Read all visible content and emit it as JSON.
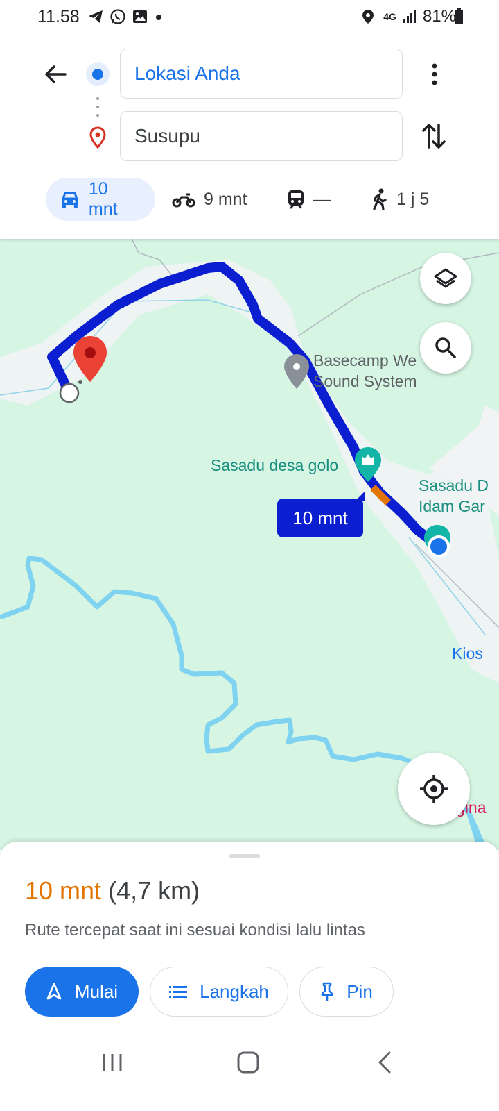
{
  "status_bar": {
    "time": "11.58",
    "network": "4G",
    "battery": "81%"
  },
  "directions": {
    "origin": "Lokasi Anda",
    "destination": "Susupu"
  },
  "modes": [
    {
      "name": "car",
      "label": "10 mnt",
      "selected": true
    },
    {
      "name": "motorcycle",
      "label": "9 mnt",
      "selected": false
    },
    {
      "name": "transit",
      "label": "—",
      "selected": false
    },
    {
      "name": "walk",
      "label": "1 j 5",
      "selected": false
    }
  ],
  "map": {
    "labels": {
      "basecamp_line1": "Basecamp We",
      "basecamp_line2": "Sound System",
      "sasadu_golo": "Sasadu desa golo",
      "sasadu_d_line1": "Sasadu D",
      "sasadu_d_line2": "Idam Gar",
      "kios": "Kios",
      "pink": "gina"
    },
    "route_badge": "10 mnt",
    "colors": {
      "route": "#0b1fd1",
      "land": "#d6f5e3",
      "river": "#7fd3f0",
      "road": "#f1f3f4"
    }
  },
  "sheet": {
    "duration": "10 mnt",
    "distance": "(4,7 km)",
    "description": "Rute tercepat saat ini sesuai kondisi lalu lintas",
    "buttons": {
      "start": "Mulai",
      "steps": "Langkah",
      "pin": "Pin"
    }
  }
}
